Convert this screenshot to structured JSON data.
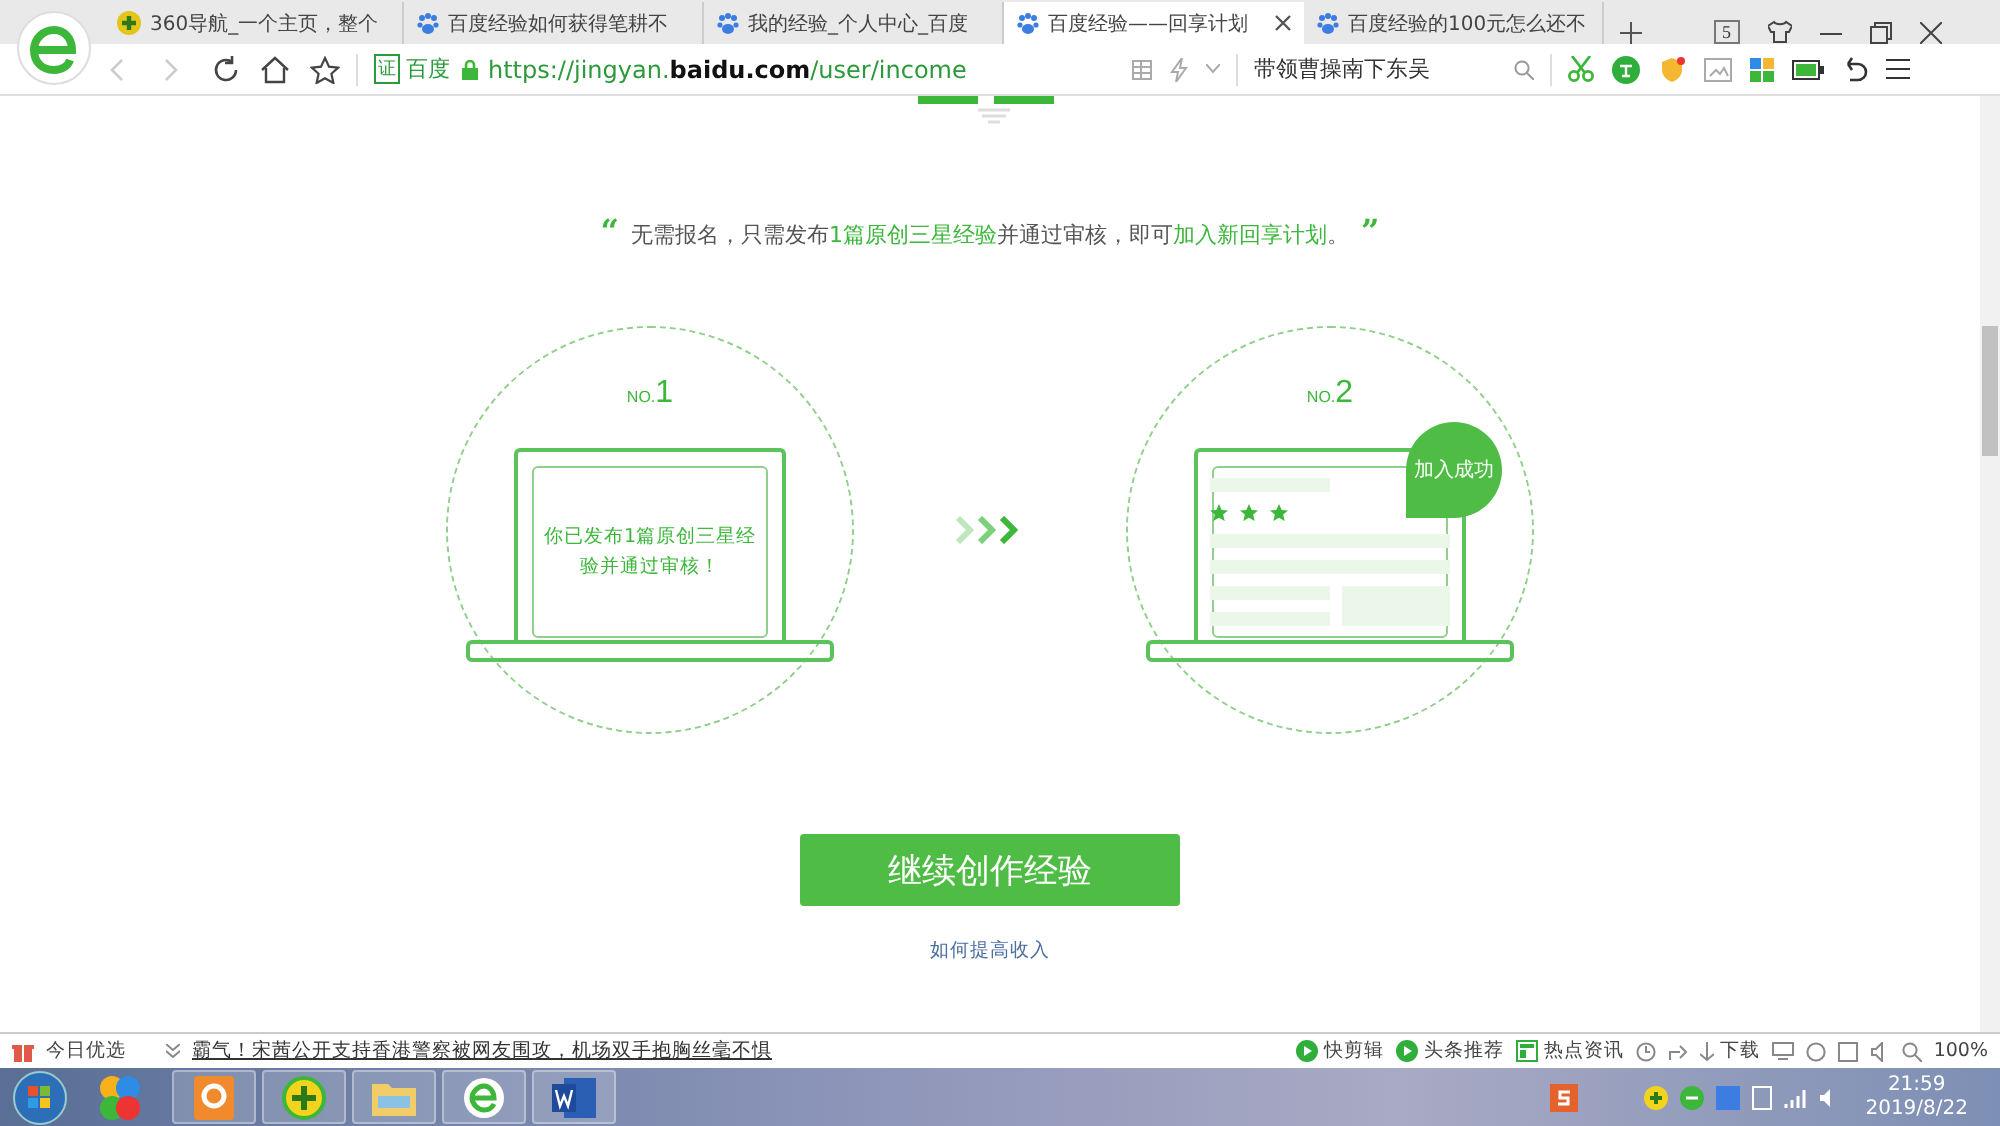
{
  "tabs": [
    {
      "title": "360导航_一个主页，整个",
      "selected": false
    },
    {
      "title": "百度经验如何获得笔耕不",
      "selected": false
    },
    {
      "title": "我的经验_个人中心_百度",
      "selected": false
    },
    {
      "title": "百度经验——回享计划",
      "selected": true
    },
    {
      "title": "百度经验的100元怎么还不",
      "selected": false
    }
  ],
  "tab_count": "5",
  "address_bar": {
    "badge": "证",
    "site": "百度",
    "url": "https://jingyan.**baidu.com**/user/income"
  },
  "search": {
    "value": "带领曹操南下东吴"
  },
  "page": {
    "quote_open": "“",
    "quote_close": "”",
    "intro": "无需报名，只需发布**1篇原创三星经验**并通过审核，即可**加入新回享计划**。",
    "steps": [
      {
        "kind": "message",
        "prefix": "NO.",
        "number": "1",
        "text": "你已发布1篇原创三星经验并通过审核！"
      },
      {
        "kind": "preview",
        "prefix": "NO.",
        "number": "2",
        "badge": "加入成功",
        "stars": 3
      }
    ],
    "primary_button": "继续创作经验",
    "link": "如何提高收入"
  },
  "status_bar": {
    "label": "今日优选",
    "news": "霸气！宋茜公开支持香港警察被网友围攻，机场双手抱胸丝毫不惧",
    "items": [
      "快剪辑",
      "头条推荐",
      "热点资讯"
    ],
    "download": "下载",
    "zoom": "100%"
  },
  "taskbar": {
    "time": "21:59",
    "date": "2019/8/22"
  }
}
